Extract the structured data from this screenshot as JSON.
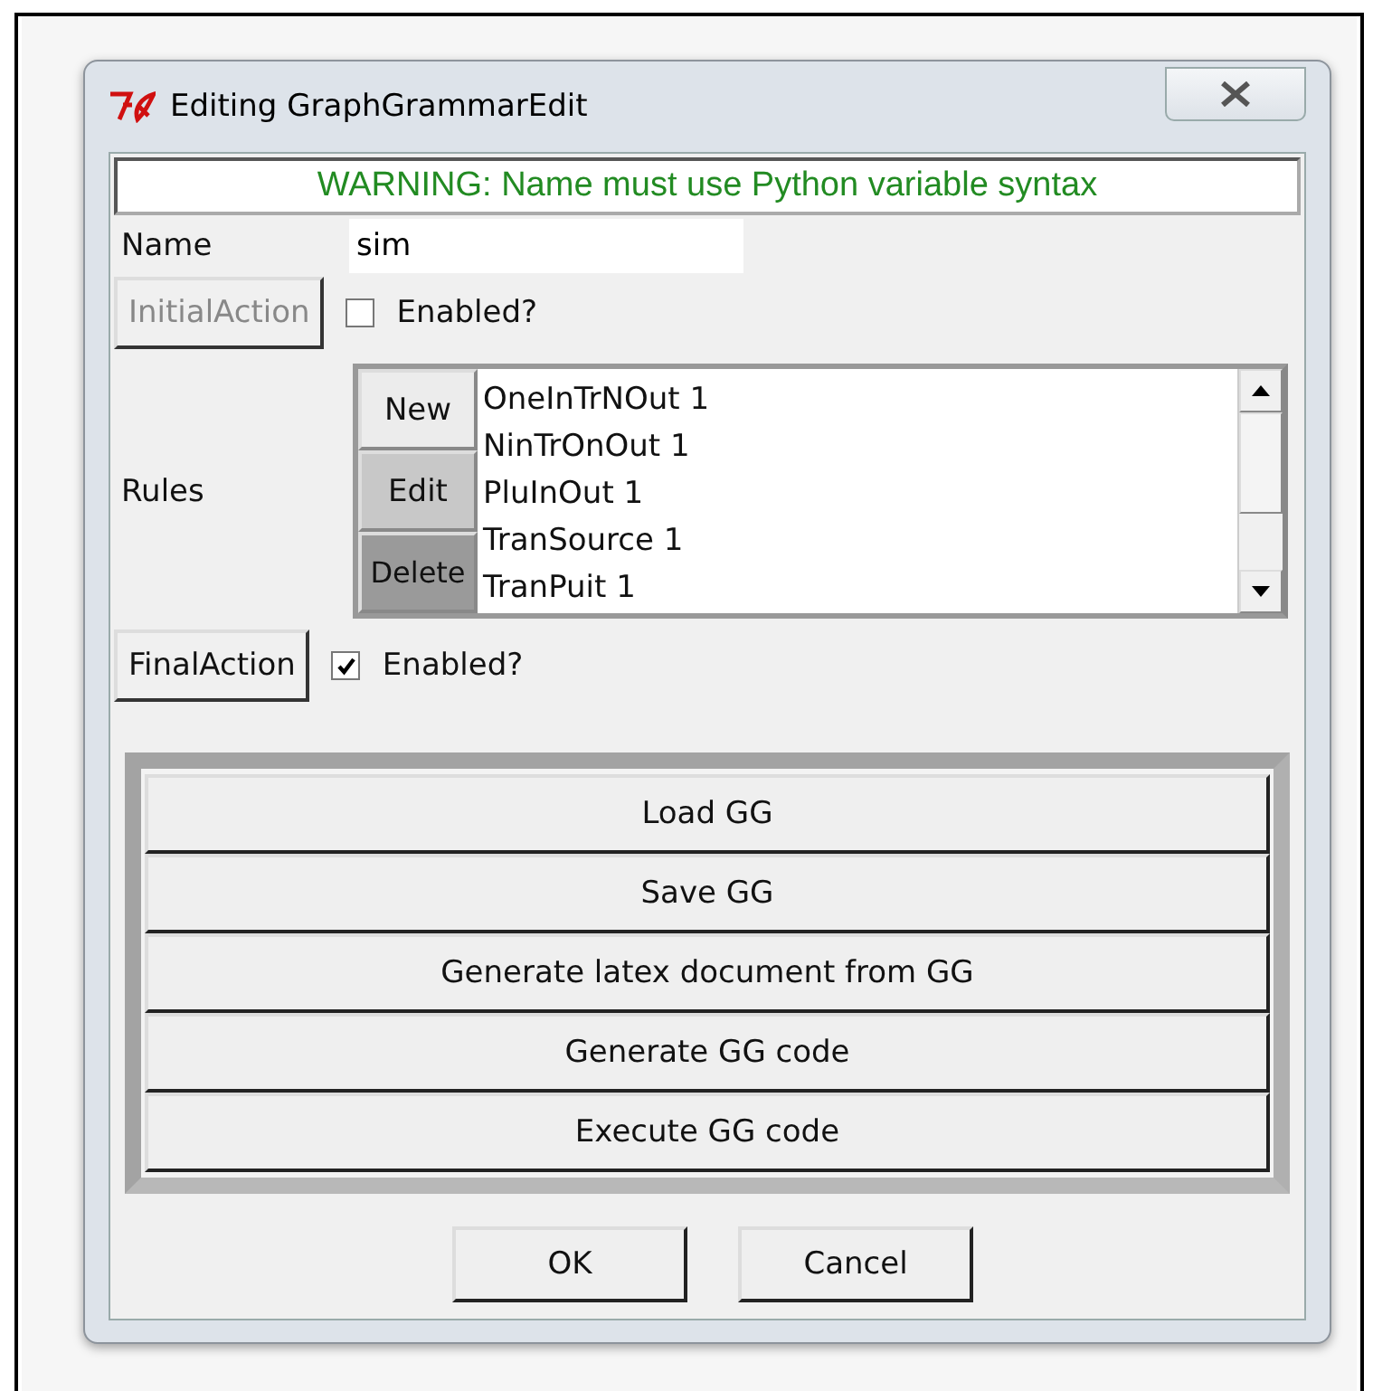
{
  "window": {
    "title": "Editing GraphGrammarEdit"
  },
  "warning": "WARNING: Name must use Python variable syntax",
  "name_field": {
    "label": "Name",
    "value": "sim"
  },
  "initial_action": {
    "label": "InitialAction",
    "disabled": true,
    "checkbox": {
      "label": "Enabled?",
      "checked": false
    }
  },
  "rules": {
    "label": "Rules",
    "buttons": [
      "New",
      "Edit",
      "Delete"
    ],
    "items": [
      "OneInTrNOut 1",
      "NinTrOnOut 1",
      "PluInOut 1",
      "TranSource 1",
      "TranPuit 1"
    ]
  },
  "final_action": {
    "label": "FinalAction",
    "disabled": false,
    "checkbox": {
      "label": "Enabled?",
      "checked": true
    }
  },
  "actions": [
    "Load GG",
    "Save GG",
    "Generate latex document from GG",
    "Generate GG code",
    "Execute GG code"
  ],
  "buttons": [
    "OK",
    "Cancel"
  ]
}
